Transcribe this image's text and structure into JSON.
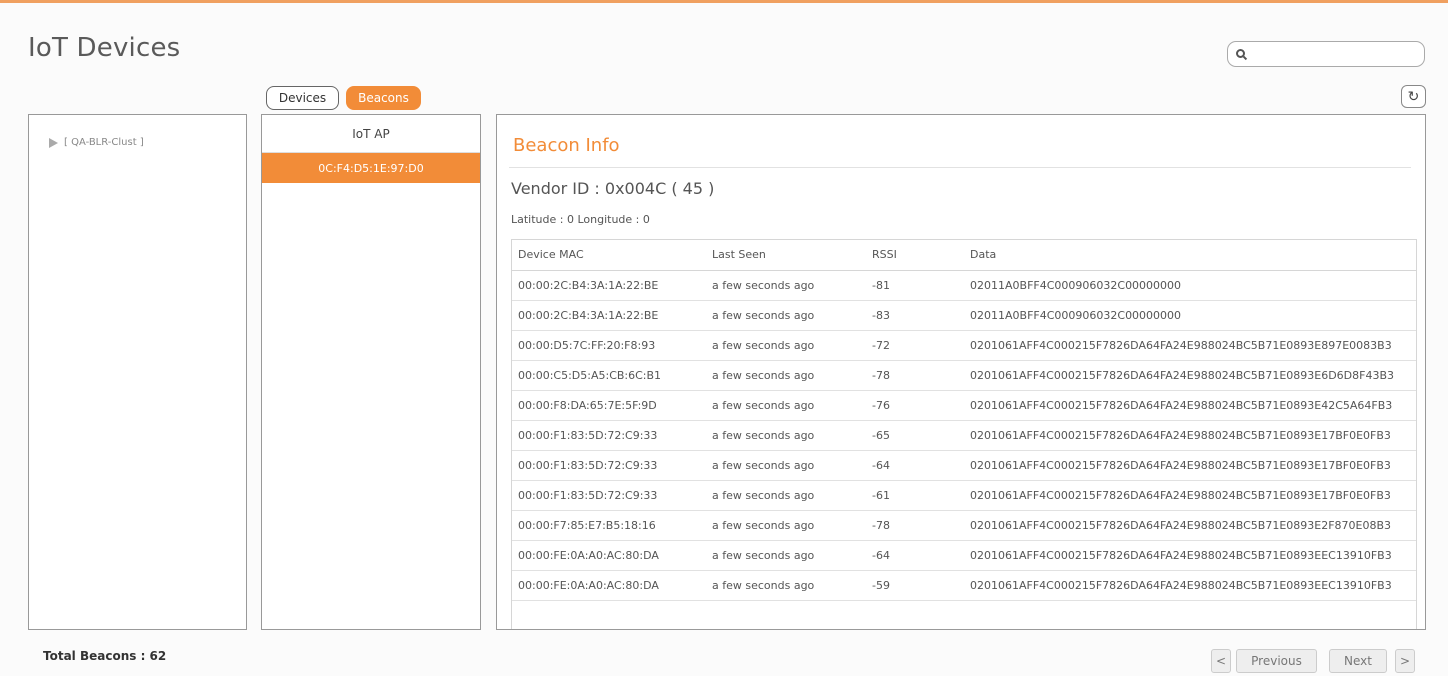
{
  "page": {
    "title": "IoT Devices"
  },
  "search": {
    "placeholder": "",
    "value": ""
  },
  "icons": {
    "search": "search-icon",
    "refresh": "refresh-icon",
    "tree_expand": "triangle-right-icon",
    "prev": "chevron-left-icon",
    "next": "chevron-right-icon"
  },
  "colors": {
    "accent": "#f28c38",
    "border": "#999999"
  },
  "toggle": {
    "devices_label": "Devices",
    "beacons_label": "Beacons",
    "selected": "Beacons"
  },
  "tree": {
    "items": [
      {
        "label": "[ QA-BLR-Clust ]"
      }
    ]
  },
  "ap_list": {
    "header": "IoT AP",
    "selected_row": "0C:F4:D5:1E:97:D0"
  },
  "beacon_info": {
    "title": "Beacon Info",
    "vendor_id": "Vendor ID : 0x004C ( 45 )",
    "location": "Latitude : 0 Longitude : 0",
    "columns": [
      "Device MAC",
      "Last Seen",
      "RSSI",
      "Data"
    ],
    "rows": [
      [
        "00:00:2C:B4:3A:1A:22:BE",
        "a few seconds ago",
        "-81",
        "02011A0BFF4C000906032C00000000"
      ],
      [
        "00:00:2C:B4:3A:1A:22:BE",
        "a few seconds ago",
        "-83",
        "02011A0BFF4C000906032C00000000"
      ],
      [
        "00:00:D5:7C:FF:20:F8:93",
        "a few seconds ago",
        "-72",
        "0201061AFF4C000215F7826DA64FA24E988024BC5B71E0893E897E0083B3"
      ],
      [
        "00:00:C5:D5:A5:CB:6C:B1",
        "a few seconds ago",
        "-78",
        "0201061AFF4C000215F7826DA64FA24E988024BC5B71E0893E6D6D8F43B3"
      ],
      [
        "00:00:F8:DA:65:7E:5F:9D",
        "a few seconds ago",
        "-76",
        "0201061AFF4C000215F7826DA64FA24E988024BC5B71E0893E42C5A64FB3"
      ],
      [
        "00:00:F1:83:5D:72:C9:33",
        "a few seconds ago",
        "-65",
        "0201061AFF4C000215F7826DA64FA24E988024BC5B71E0893E17BF0E0FB3"
      ],
      [
        "00:00:F1:83:5D:72:C9:33",
        "a few seconds ago",
        "-64",
        "0201061AFF4C000215F7826DA64FA24E988024BC5B71E0893E17BF0E0FB3"
      ],
      [
        "00:00:F1:83:5D:72:C9:33",
        "a few seconds ago",
        "-61",
        "0201061AFF4C000215F7826DA64FA24E988024BC5B71E0893E17BF0E0FB3"
      ],
      [
        "00:00:F7:85:E7:B5:18:16",
        "a few seconds ago",
        "-78",
        "0201061AFF4C000215F7826DA64FA24E988024BC5B71E0893E2F870E08B3"
      ],
      [
        "00:00:FE:0A:A0:AC:80:DA",
        "a few seconds ago",
        "-64",
        "0201061AFF4C000215F7826DA64FA24E988024BC5B71E0893EEC13910FB3"
      ],
      [
        "00:00:FE:0A:A0:AC:80:DA",
        "a few seconds ago",
        "-59",
        "0201061AFF4C000215F7826DA64FA24E988024BC5B71E0893EEC13910FB3"
      ]
    ]
  },
  "footer": {
    "total_label": "Total Beacons : 62",
    "prev_label": "Previous",
    "next_label": "Next",
    "prev_arrow": "<",
    "next_arrow": ">"
  }
}
